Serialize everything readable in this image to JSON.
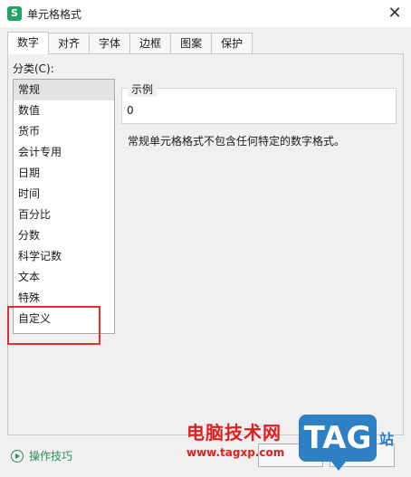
{
  "window": {
    "title": "单元格格式",
    "close_glyph": "✕",
    "app_icon_letter": "S"
  },
  "tabs": [
    {
      "label": "数字",
      "active": true
    },
    {
      "label": "对齐"
    },
    {
      "label": "字体"
    },
    {
      "label": "边框"
    },
    {
      "label": "图案"
    },
    {
      "label": "保护"
    }
  ],
  "category": {
    "label": "分类(C):",
    "items": [
      "常规",
      "数值",
      "货币",
      "会计专用",
      "日期",
      "时间",
      "百分比",
      "分数",
      "科学记数",
      "文本",
      "特殊",
      "自定义"
    ],
    "selected": "常规",
    "highlighted": "自定义"
  },
  "example": {
    "label": "示例",
    "value": "0"
  },
  "description": "常规单元格格式不包含任何特定的数字格式。",
  "footer": {
    "tips_label": "操作技巧",
    "ok_label": "",
    "cancel_label": ""
  },
  "watermark": {
    "site_name": "电脑技术网",
    "site_url": "www.tagxp.com",
    "logo_text": "TAG",
    "logo_side": "站"
  },
  "colors": {
    "accent_green": "#21a366",
    "highlight_red": "#e03030",
    "watermark_blue": "#2e7fc4"
  }
}
